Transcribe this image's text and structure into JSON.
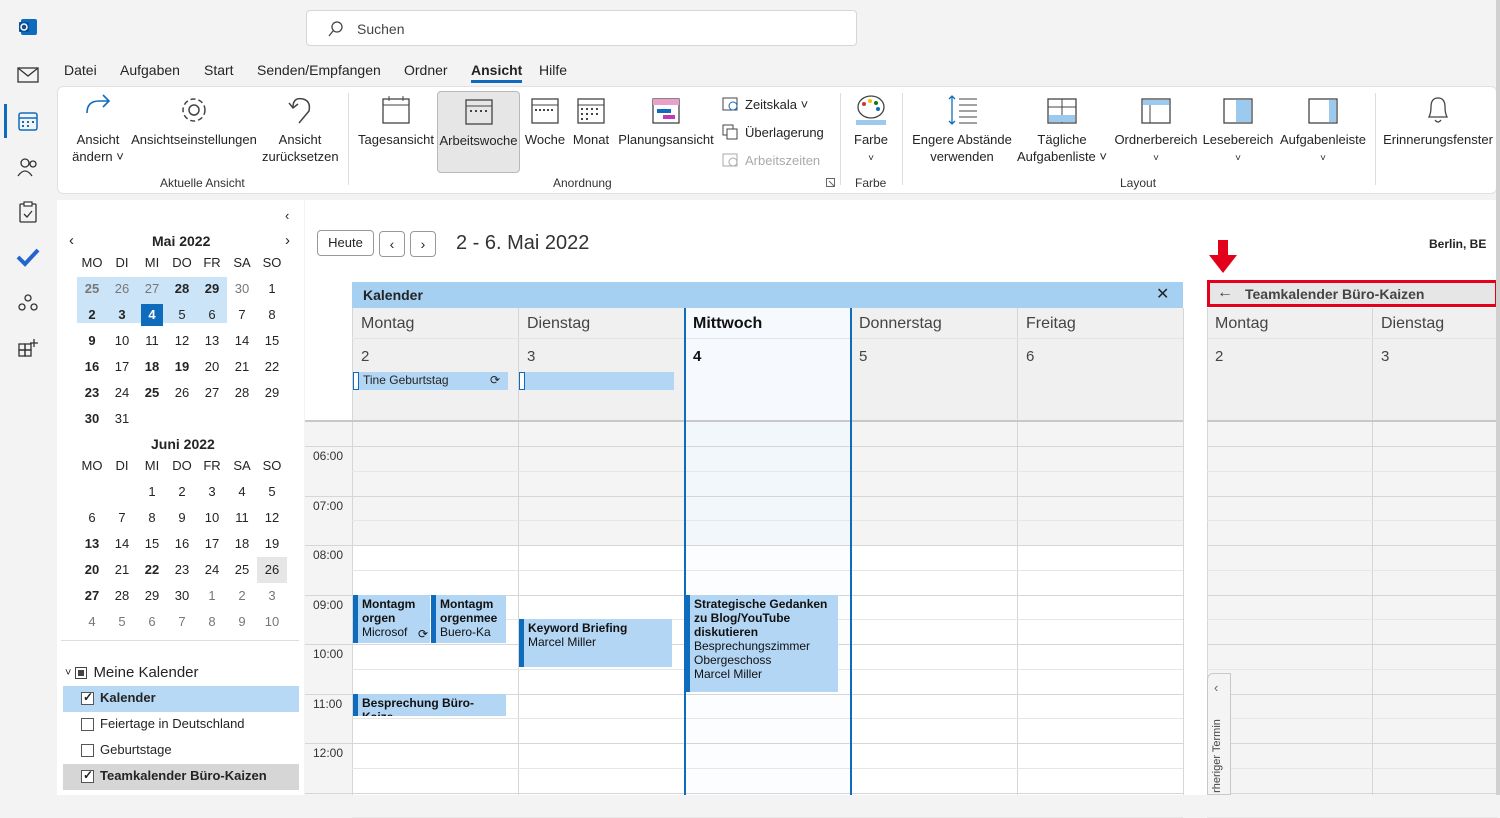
{
  "search": {
    "placeholder": "Suchen"
  },
  "menu": [
    "Datei",
    "Aufgaben",
    "Start",
    "Senden/Empfangen",
    "Ordner",
    "Ansicht",
    "Hilfe"
  ],
  "ribbon": {
    "ansicht_aendern": [
      "Ansicht",
      "ändern ˅"
    ],
    "ansichtseinstellungen": "Ansichtseinstellungen",
    "ansicht_zurueck": [
      "Ansicht",
      "zurücksetzen"
    ],
    "group_aktuelle": "Aktuelle Ansicht",
    "tagesansicht": "Tagesansicht",
    "arbeitswoche": "Arbeitswoche",
    "woche": "Woche",
    "monat": "Monat",
    "planungsansicht": "Planungsansicht",
    "zeitskala": "Zeitskala ˅",
    "ueberlagerung": "Überlagerung",
    "arbeitszeiten": "Arbeitszeiten",
    "group_anordnung": "Anordnung",
    "farbe": "Farbe",
    "group_farbe": "Farbe",
    "engere": [
      "Engere Abstände",
      "verwenden"
    ],
    "taegliche": [
      "Tägliche",
      "Aufgabenliste ˅"
    ],
    "ordnerbereich": "Ordnerbereich",
    "lesebereich": "Lesebereich",
    "aufgabenleiste": "Aufgabenleiste",
    "group_layout": "Layout",
    "erinnerung": "Erinnerungsfenster"
  },
  "minical": {
    "may_title": "Mai 2022",
    "june_title": "Juni 2022",
    "weekdays": [
      "MO",
      "DI",
      "MI",
      "DO",
      "FR",
      "SA",
      "SO"
    ],
    "may": [
      [
        "25",
        "26",
        "27",
        "28",
        "29",
        "30",
        "1"
      ],
      [
        "2",
        "3",
        "4",
        "5",
        "6",
        "7",
        "8"
      ],
      [
        "9",
        "10",
        "11",
        "12",
        "13",
        "14",
        "15"
      ],
      [
        "16",
        "17",
        "18",
        "19",
        "20",
        "21",
        "22"
      ],
      [
        "23",
        "24",
        "25",
        "26",
        "27",
        "28",
        "29"
      ],
      [
        "30",
        "31",
        "",
        "",
        "",
        "",
        ""
      ]
    ],
    "june": [
      [
        "",
        "",
        "1",
        "2",
        "3",
        "4",
        "5"
      ],
      [
        "6",
        "7",
        "8",
        "9",
        "10",
        "11",
        "12"
      ],
      [
        "13",
        "14",
        "15",
        "16",
        "17",
        "18",
        "19"
      ],
      [
        "20",
        "21",
        "22",
        "23",
        "24",
        "25",
        "26"
      ],
      [
        "27",
        "28",
        "29",
        "30",
        "1",
        "2",
        "3"
      ],
      [
        "4",
        "5",
        "6",
        "7",
        "8",
        "9",
        "10"
      ]
    ]
  },
  "calendars": {
    "group": "Meine Kalender",
    "items": [
      {
        "label": "Kalender",
        "checked": true
      },
      {
        "label": "Feiertage in Deutschland",
        "checked": false
      },
      {
        "label": "Geburtstage",
        "checked": false
      },
      {
        "label": "Teamkalender Büro-Kaizen",
        "checked": true
      }
    ]
  },
  "nav": {
    "today": "Heute",
    "range": "2 - 6. Mai 2022",
    "location": "Berlin, BE"
  },
  "cal1": {
    "title": "Kalender",
    "days": [
      {
        "name": "Montag",
        "num": "2"
      },
      {
        "name": "Dienstag",
        "num": "3"
      },
      {
        "name": "Mittwoch",
        "num": "4"
      },
      {
        "name": "Donnerstag",
        "num": "5"
      },
      {
        "name": "Freitag",
        "num": "6"
      }
    ]
  },
  "cal2": {
    "title": "Teamkalender Büro-Kaizen",
    "days": [
      {
        "name": "Montag",
        "num": "2"
      },
      {
        "name": "Dienstag",
        "num": "3"
      }
    ]
  },
  "times": [
    "06:00",
    "07:00",
    "08:00",
    "09:00",
    "10:00",
    "11:00",
    "12:00"
  ],
  "events": {
    "birthday": "Tine Geburtstag",
    "mon1": [
      "Montagm",
      "orgen",
      "Microsof"
    ],
    "mon2": [
      "Montagm",
      "orgenmee",
      "Buero-Ka"
    ],
    "keyword": [
      "Keyword Briefing",
      "Marcel Miller"
    ],
    "strategie": [
      "Strategische Gedanken",
      "zu Blog/YouTube",
      "diskutieren",
      "Besprechungszimmer",
      "Obergeschoss",
      "Marcel Miller"
    ],
    "bespr": "Besprechung Büro-Kaize"
  },
  "side_tab": "rheriger Termin",
  "colors": {
    "accent": "#0f6cbd",
    "highlight": "#e3001b",
    "event": "#b3d6f5"
  }
}
